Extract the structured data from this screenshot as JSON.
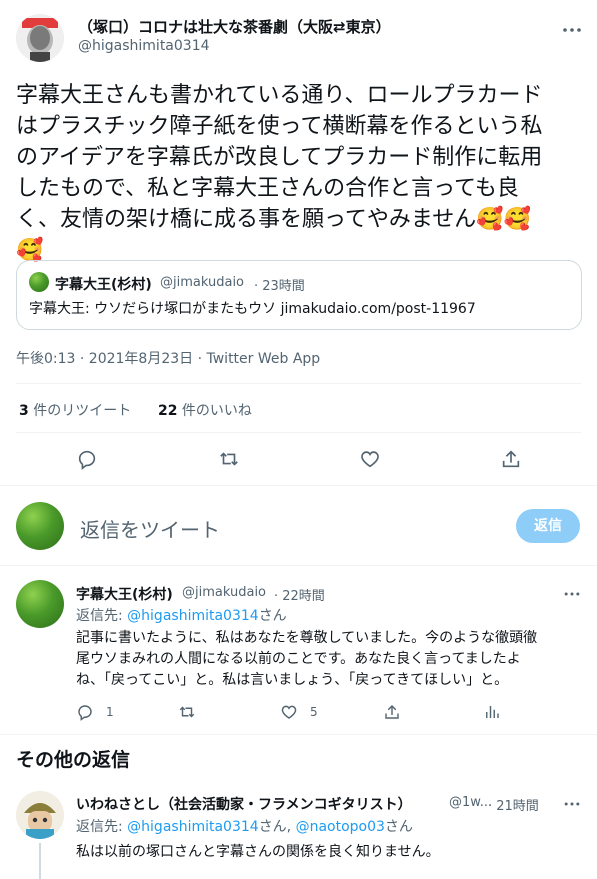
{
  "tweet": {
    "author_name": "（塚口）コロナは壮大な茶番劇（大阪⇄東京）",
    "author_handle": "@higashimita0314",
    "text_lines": [
      "字幕大王さんも書かれている通り、ロールプラカード",
      "はプラスチック障子紙を使って横断幕を作るという私",
      "のアイデアを字幕氏が改良してプラカード制作に転用",
      "したもので、私と字幕大王さんの合作と言っても良",
      "く、友情の架け橋に成る事を願ってやみません🥰🥰",
      "🥰"
    ],
    "quote": {
      "author_name": "字幕大王(杉村)",
      "author_handle": "@jimakudaio",
      "time": "· 23時間",
      "text_prefix": "字幕大王: ウソだらけ塚口がまたもウソ ",
      "text_link": "jimakudaio.com/post-11967"
    },
    "timestamp": "午後0:13 · 2021年8月23日 · Twitter Web App",
    "retweet_count": "3",
    "retweet_label": " 件のリツイート",
    "like_count": "22",
    "like_label": " 件のいいね"
  },
  "compose": {
    "placeholder": "返信をツイート",
    "button_label": "返信"
  },
  "replies": [
    {
      "author_name": "字幕大王(杉村)",
      "author_handle": "@jimakudaio",
      "time": "· 22時間",
      "reply_to_prefix": "返信先: ",
      "reply_to_link": "@higashimita0314",
      "reply_to_suffix": "さん",
      "text_lines": [
        "記事に書いたように、私はあなたを尊敬していました。今のような徹頭徹",
        "尾ウソまみれの人間になる以前のことです。あなた良く言ってましたよ",
        "ね、「戻ってこい」と。私は言いましょう、「戻ってきてほしい」と。"
      ],
      "reply_count": "1",
      "like_count": "5"
    }
  ],
  "more_replies_heading": "その他の返信",
  "more_replies": [
    {
      "author_name": "いわねさとし（社会活動家・フラメンコギタリスト）",
      "author_handle": "@1w...",
      "time": "· 21時間",
      "reply_to_prefix": "返信先: ",
      "reply_to_link1": "@higashimita0314",
      "reply_to_mid": "さん, ",
      "reply_to_link2": "@naotopo03",
      "reply_to_suffix": "さん",
      "text": "私は以前の塚口さんと字幕さんの関係を良く知りません。"
    }
  ]
}
